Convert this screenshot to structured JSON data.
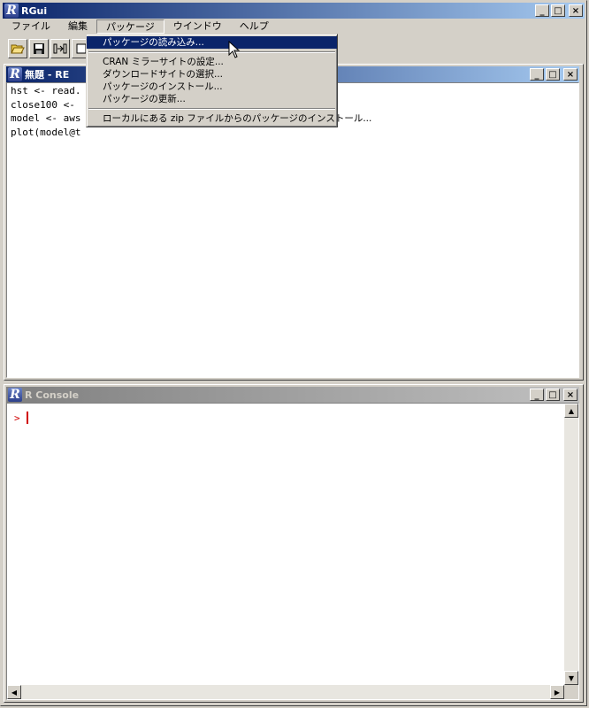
{
  "app": {
    "title": "RGui"
  },
  "menubar": {
    "items": [
      "ファイル",
      "編集",
      "パッケージ",
      "ウインドウ",
      "ヘルプ"
    ]
  },
  "toolbar": {
    "buttons": [
      "open-icon",
      "save-icon",
      "load-workspace-icon",
      "copy-icon"
    ]
  },
  "packages_menu": {
    "items": [
      "パッケージの読み込み...",
      "CRAN ミラーサイトの設定...",
      "ダウンロードサイトの選択...",
      "パッケージのインストール...",
      "パッケージの更新...",
      "ローカルにある zip ファイルからのパッケージのインストール..."
    ]
  },
  "editor": {
    "title": "無題 - RE",
    "lines": [
      "hst <- read.",
      "close100 <-",
      "model <- aws",
      "plot(model@t"
    ]
  },
  "console": {
    "title": "R Console",
    "prompt": ">"
  },
  "window_buttons": {
    "minimize": "_",
    "maximize": "□",
    "close": "×"
  },
  "colors": {
    "active_title": "#0a246a",
    "inactive_title": "#808080",
    "prompt": "#d00000",
    "highlight": "#0a246a"
  }
}
